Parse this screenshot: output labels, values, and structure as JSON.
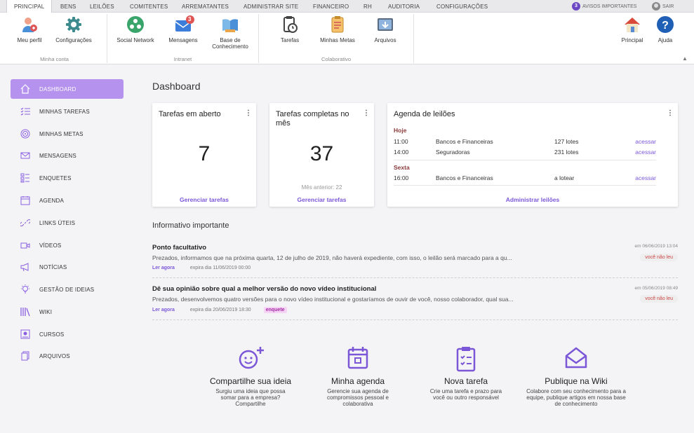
{
  "menu": {
    "items": [
      "PRINCIPAL",
      "BENS",
      "LEILÕES",
      "COMITENTES",
      "ARREMATANTES",
      "ADMINISTRAR SITE",
      "FINANCEIRO",
      "RH",
      "AUDITORIA",
      "CONFIGURAÇÕES"
    ],
    "notices_count": "3",
    "notices_label": "AVISOS IMPORTANTES",
    "logout_label": "SAIR"
  },
  "ribbon": {
    "meu_perfil": "Meu perfil",
    "configuracoes": "Configurações",
    "social_network": "Social Network",
    "mensagens": "Mensagens",
    "mensagens_badge": "3",
    "base_conhecimento": "Base de Conhecimento",
    "tarefas": "Tarefas",
    "minhas_metas": "Minhas Metas",
    "arquivos": "Arquivos",
    "principal": "Principal",
    "ajuda": "Ajuda",
    "group_minha_conta": "Minha conta",
    "group_intranet": "Intranet",
    "group_colaborativo": "Colaborativo"
  },
  "sidebar": {
    "items": [
      "DASHBOARD",
      "MINHAS TAREFAS",
      "MINHAS METAS",
      "MENSAGENS",
      "ENQUETES",
      "AGENDA",
      "LINKS ÚTEIS",
      "VÍDEOS",
      "NOTÍCIAS",
      "GESTÃO DE IDEIAS",
      "WIKI",
      "CURSOS",
      "ARQUIVOS"
    ]
  },
  "main": {
    "title": "Dashboard",
    "card_open": {
      "title": "Tarefas em aberto",
      "value": "7",
      "link": "Gerenciar tarefas"
    },
    "card_done": {
      "title": "Tarefas completas no mês",
      "value": "37",
      "previous": "Mês anterior: 22",
      "link": "Gerenciar tarefas"
    },
    "agenda": {
      "title": "Agenda de leilões",
      "day1": "Hoje",
      "rows1": [
        {
          "time": "11:00",
          "name": "Bancos e Financeiras",
          "lots": "127 lotes",
          "action": "acessar"
        },
        {
          "time": "14:00",
          "name": "Seguradoras",
          "lots": "231 lotes",
          "action": "acessar"
        }
      ],
      "day2": "Sexta",
      "rows2": [
        {
          "time": "16:00",
          "name": "Bancos e Financeiras",
          "lots": "a lotear",
          "action": "acessar"
        }
      ],
      "link": "Administrar leilões"
    },
    "informativo": {
      "title": "Informativo importante",
      "items": [
        {
          "title": "Ponto facultativo",
          "desc": "Prezados, informamos que na próxima quarta, 12 de julho de 2019, não haverá expediente, com isso, o leilão será marcado para a qu...",
          "read": "Ler agora",
          "expires": "expira dia 11/06/2019 00:00",
          "date": "em 06/06/2019 13:04",
          "status": "você não leu"
        },
        {
          "title": "Dê sua opinião sobre qual a melhor versão do novo vídeo institucional",
          "desc": "Prezados, desenvolvemos quatro versões para o novo vídeo institucional e gostaríamos de ouvir de você, nosso colaborador, qual sua...",
          "read": "Ler agora",
          "expires": "expira dia 20/06/2019 18:30",
          "tag": "enquete",
          "date": "em 05/06/2019 08:49",
          "status": "você não leu"
        }
      ]
    },
    "actions": [
      {
        "title": "Compartilhe sua ideia",
        "desc": "Surgiu uma ideia que possa somar para a empresa? Compartilhe"
      },
      {
        "title": "Minha agenda",
        "desc": "Gerencie sua agenda de compromissos pessoal e colaborativa"
      },
      {
        "title": "Nova tarefa",
        "desc": "Crie uma tarefa e prazo para você ou outro responsável"
      },
      {
        "title": "Publique na Wiki",
        "desc": "Colabore com seu conhecimento para a equipe, publique artigos em nossa base de conhecimento"
      }
    ]
  },
  "colors": {
    "accent": "#b492ee",
    "link": "#7b57d8",
    "agenda_day": "#8b3a3a"
  }
}
